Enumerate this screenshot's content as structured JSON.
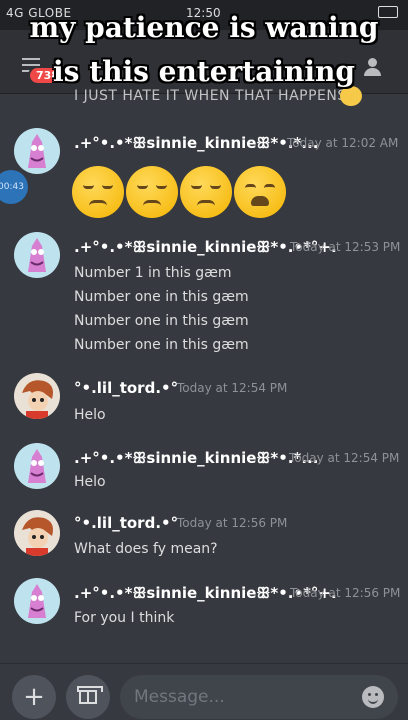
{
  "caption": {
    "line1": "my patience is waning",
    "line2": "is this entertaining"
  },
  "status_bar": {
    "carrier": "4G GLOBE",
    "time": "12:50"
  },
  "header": {
    "unread_badge": "738"
  },
  "previous_message": {
    "text": "I JUST HATE IT WHEN THAT HAPPENS"
  },
  "unread_pill": "00:43",
  "messages": [
    {
      "author": ".+°•.•*ꕥsinnie_kinnieꕥ*•.*...",
      "timestamp": "Today at 12:02 AM",
      "lines": [],
      "emojis": [
        "pensive-face",
        "pensive-face",
        "pensive-face",
        "weary-face"
      ]
    },
    {
      "author": ".+°•.•*ꕥsinnie_kinnieꕥ*•.•*°+.",
      "timestamp": "Today at 12:53 PM",
      "lines": [
        "Number 1 in this gæm",
        "Number one in this gæm",
        "Number one in this gæm",
        "Number one in this gæm"
      ]
    },
    {
      "author": "°•.lil_tord.•°",
      "timestamp": "Today at 12:54 PM",
      "lines": [
        "Helo"
      ]
    },
    {
      "author": ".+°•.•*ꕥsinnie_kinnieꕥ*•.*...",
      "timestamp": "Today at 12:54 PM",
      "lines": [
        "Helo"
      ]
    },
    {
      "author": "°•.lil_tord.•°",
      "timestamp": "Today at 12:56 PM",
      "lines": [
        "What does fy mean?"
      ]
    },
    {
      "author": ".+°•.•*ꕥsinnie_kinnieꕥ*•.•*°+.",
      "timestamp": "Today at 12:56 PM",
      "lines": [
        "For you I think"
      ]
    }
  ],
  "composer": {
    "placeholder": "Message..."
  },
  "colors": {
    "background": "#36393f",
    "header": "#2f3136",
    "badge": "#f04747",
    "timestamp": "#8e9297"
  }
}
